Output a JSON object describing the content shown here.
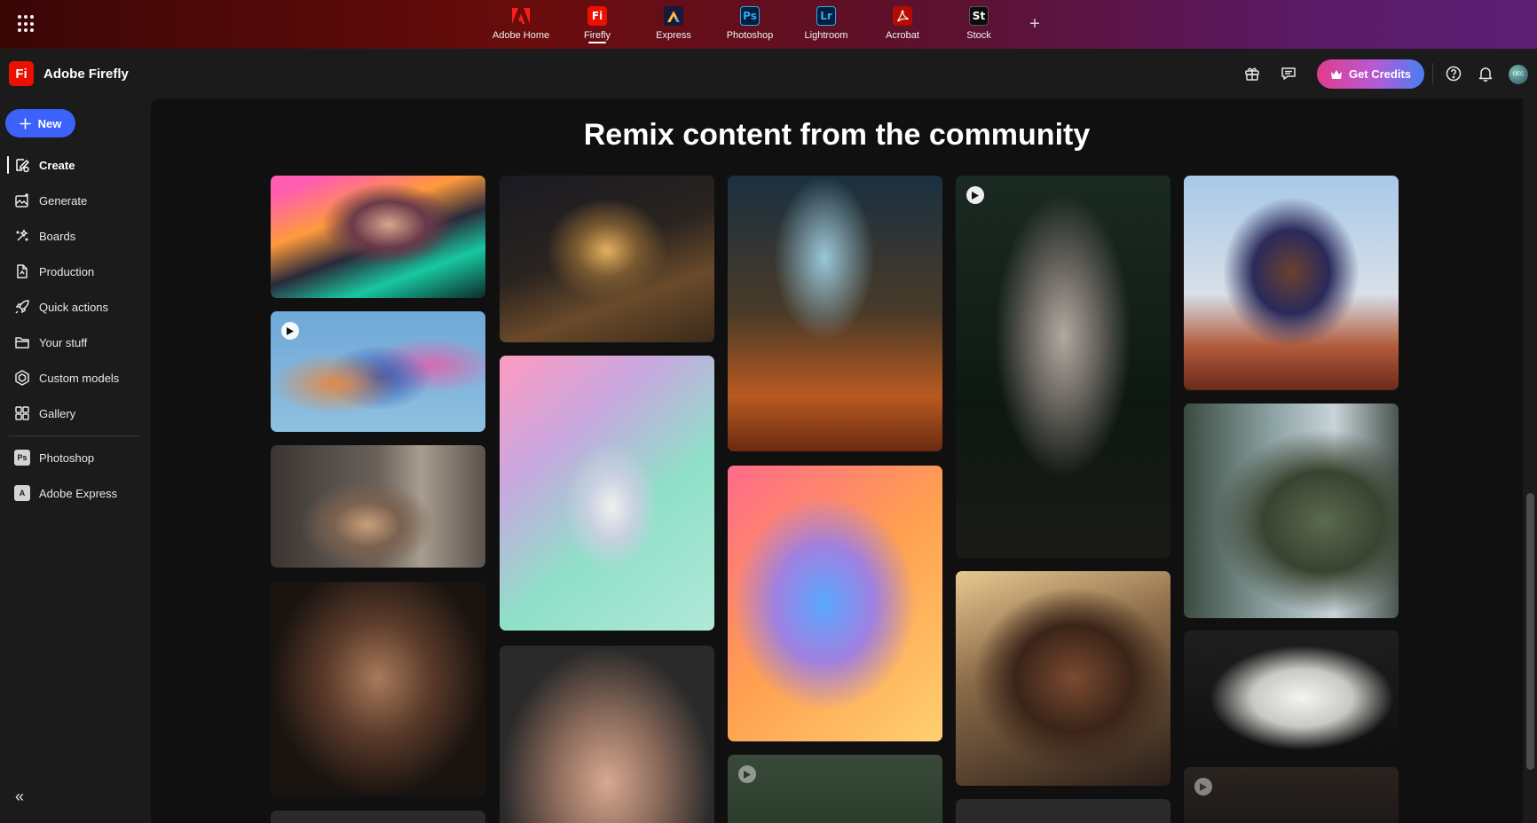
{
  "top_apps": [
    {
      "label": "Adobe Home",
      "glyph": "A",
      "bg": "transparent",
      "color": "#ff1a1a"
    },
    {
      "label": "Firefly",
      "glyph": "Fi",
      "bg": "#eb1000",
      "color": "#ffffff"
    },
    {
      "label": "Express",
      "glyph": "A",
      "bg": "#141a3a",
      "color": "#ffcc33"
    },
    {
      "label": "Photoshop",
      "glyph": "Ps",
      "bg": "#001e36",
      "color": "#31a8ff"
    },
    {
      "label": "Lightroom",
      "glyph": "Lr",
      "bg": "#001e36",
      "color": "#31a8ff"
    },
    {
      "label": "Acrobat",
      "glyph": "A",
      "bg": "#b30b00",
      "color": "#ffffff"
    },
    {
      "label": "Stock",
      "glyph": "St",
      "bg": "#0c0c0c",
      "color": "#ffffff"
    }
  ],
  "header": {
    "brand_glyph": "Fi",
    "brand_name": "Adobe Firefly",
    "credits_label": "Get Credits",
    "avatar_text": "OEC"
  },
  "sidebar": {
    "new_label": "New",
    "items": [
      {
        "label": "Create",
        "icon": "create-icon"
      },
      {
        "label": "Generate",
        "icon": "generate-icon"
      },
      {
        "label": "Boards",
        "icon": "boards-icon"
      },
      {
        "label": "Production",
        "icon": "production-icon"
      },
      {
        "label": "Quick actions",
        "icon": "rocket-icon"
      },
      {
        "label": "Your stuff",
        "icon": "folder-icon"
      },
      {
        "label": "Custom models",
        "icon": "models-icon"
      },
      {
        "label": "Gallery",
        "icon": "gallery-icon"
      }
    ],
    "apps": [
      {
        "label": "Photoshop",
        "glyph": "Ps"
      },
      {
        "label": "Adobe Express",
        "glyph": "A"
      }
    ]
  },
  "main": {
    "title": "Remix content from the community"
  },
  "colors": {
    "accent_blue": "#3b63fb",
    "firefly_red": "#eb1000",
    "credits_gradient_start": "#e23c8b",
    "credits_gradient_end": "#4a7ef2"
  }
}
